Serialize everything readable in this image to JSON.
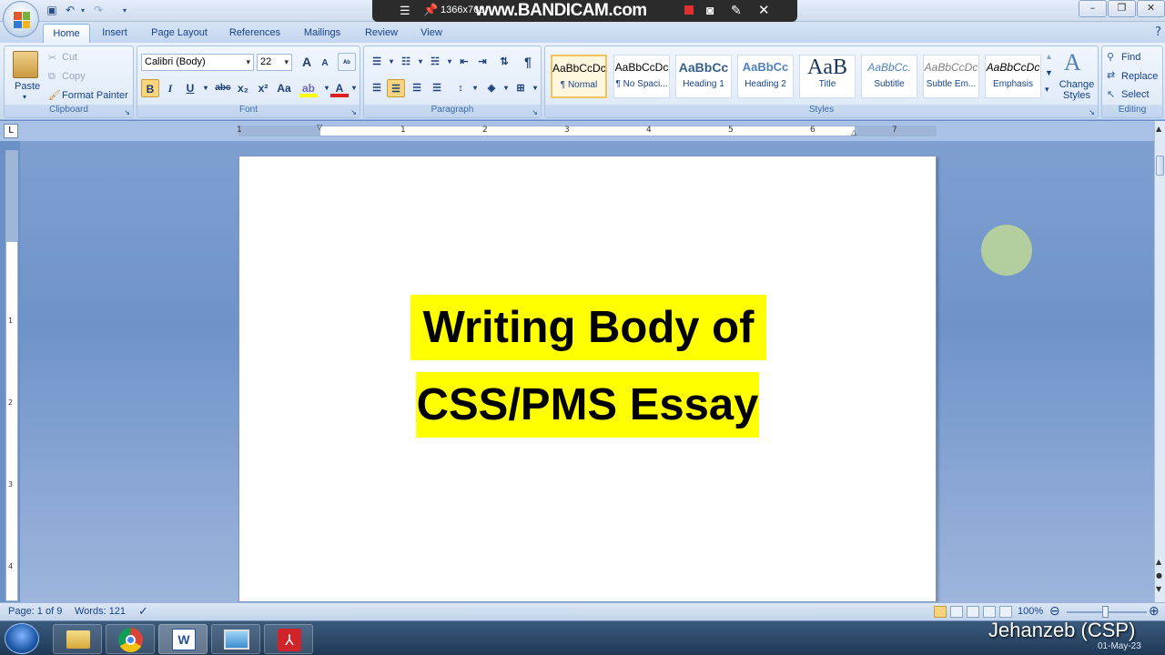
{
  "titlebar": {
    "recorder_resolution": "1366x768",
    "recorder_brand": "www.BANDICAM.com"
  },
  "tabs": [
    "Home",
    "Insert",
    "Page Layout",
    "References",
    "Mailings",
    "Review",
    "View"
  ],
  "active_tab": "Home",
  "clipboard": {
    "label": "Clipboard",
    "paste": "Paste",
    "cut": "Cut",
    "copy": "Copy",
    "format_painter": "Format Painter"
  },
  "font": {
    "label": "Font",
    "font_name": "Calibri (Body)",
    "font_size": "22",
    "bold": "B",
    "italic": "I",
    "underline": "U",
    "strikethrough": "abc",
    "subscript": "x₂",
    "superscript": "x²",
    "change_case": "Aa",
    "grow": "A",
    "shrink": "A",
    "font_color": "A",
    "highlight_color": "#ffff00",
    "font_color_value": "#ff0000"
  },
  "paragraph": {
    "label": "Paragraph",
    "show_marks": "¶"
  },
  "styles": {
    "label": "Styles",
    "items": [
      {
        "preview": "AaBbCcDc",
        "name": "¶ Normal"
      },
      {
        "preview": "AaBbCcDc",
        "name": "¶ No Spaci..."
      },
      {
        "preview": "AaBbCc",
        "name": "Heading 1"
      },
      {
        "preview": "AaBbCc",
        "name": "Heading 2"
      },
      {
        "preview": "AaB",
        "name": "Title"
      },
      {
        "preview": "AaBbCc.",
        "name": "Subtitle"
      },
      {
        "preview": "AaBbCcDc",
        "name": "Subtle Em..."
      },
      {
        "preview": "AaBbCcDc",
        "name": "Emphasis"
      }
    ],
    "change_styles": "Change Styles"
  },
  "editing": {
    "label": "Editing",
    "find": "Find",
    "replace": "Replace",
    "select": "Select"
  },
  "ruler": {
    "numbers": [
      "1",
      "1",
      "2",
      "3",
      "4",
      "5",
      "6",
      "7"
    ],
    "vnumbers": [
      "1",
      "2",
      "3",
      "4"
    ],
    "tab_stop": "L"
  },
  "document": {
    "line1": "Writing Body of",
    "line2": "CSS/PMS Essay",
    "highlight_color": "#ffff00"
  },
  "statusbar": {
    "page": "Page: 1 of 9",
    "words": "Words: 121",
    "zoom": "100%"
  },
  "taskbar": {
    "apps": [
      "start-orb",
      "file-explorer",
      "chrome",
      "word",
      "picture-viewer",
      "pdf-reader"
    ]
  },
  "overlay": {
    "watermark": "Jehanzeb (CSP)",
    "date": "01-May-23"
  }
}
